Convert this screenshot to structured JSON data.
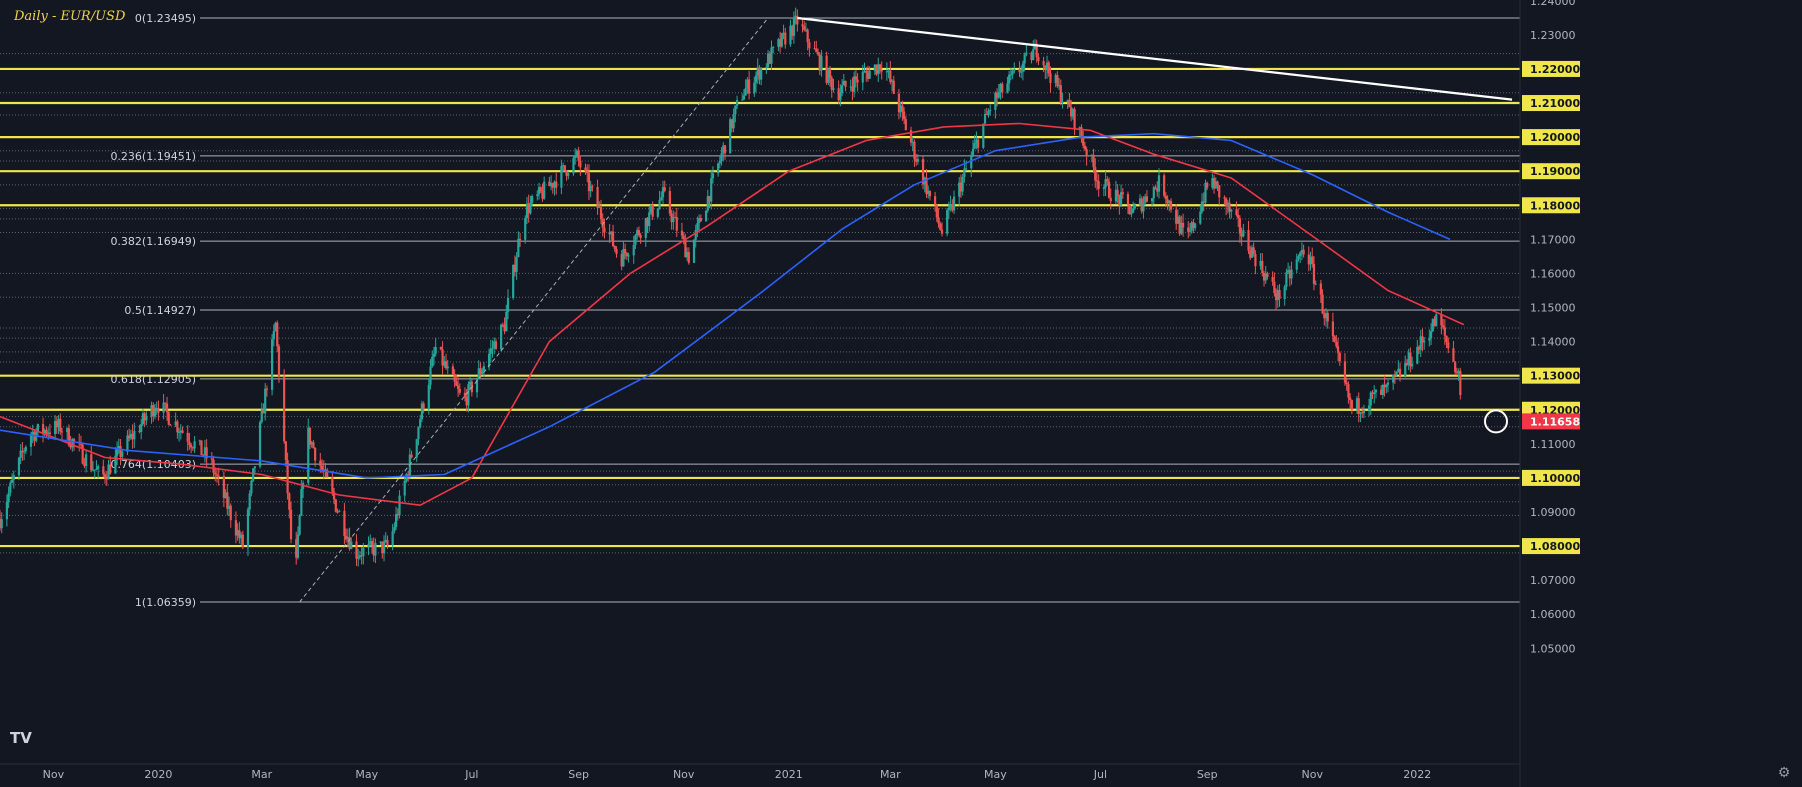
{
  "chart_data": {
    "type": "candlestick",
    "symbol": "EUR/USD",
    "interval": "Daily",
    "title": "Daily - EUR/USD",
    "last_price": 1.11658,
    "ylim": [
      1.0463,
      1.2412
    ],
    "y_ticks": [
      1.05,
      1.06,
      1.07,
      1.08,
      1.09,
      1.1,
      1.11,
      1.12,
      1.13,
      1.14,
      1.15,
      1.16,
      1.17,
      1.18,
      1.19,
      1.2,
      1.21,
      1.22,
      1.23,
      1.24
    ],
    "x_ticks": [
      {
        "label": "Nov",
        "date": "2019-11-01"
      },
      {
        "label": "2020",
        "date": "2020-01-01"
      },
      {
        "label": "Mar",
        "date": "2020-03-01"
      },
      {
        "label": "May",
        "date": "2020-05-01"
      },
      {
        "label": "Jul",
        "date": "2020-07-01"
      },
      {
        "label": "Sep",
        "date": "2020-09-01"
      },
      {
        "label": "Nov",
        "date": "2020-11-01"
      },
      {
        "label": "2021",
        "date": "2021-01-01"
      },
      {
        "label": "Mar",
        "date": "2021-03-01"
      },
      {
        "label": "May",
        "date": "2021-05-01"
      },
      {
        "label": "Jul",
        "date": "2021-07-01"
      },
      {
        "label": "Sep",
        "date": "2021-09-01"
      },
      {
        "label": "Nov",
        "date": "2021-11-01"
      },
      {
        "label": "2022",
        "date": "2022-01-01"
      }
    ],
    "price_path": [
      [
        "2019-10-01",
        1.088
      ],
      [
        "2019-10-18",
        1.113
      ],
      [
        "2019-11-05",
        1.115
      ],
      [
        "2019-11-29",
        1.1
      ],
      [
        "2019-12-31",
        1.122
      ],
      [
        "2020-01-31",
        1.105
      ],
      [
        "2020-02-19",
        1.08
      ],
      [
        "2020-03-09",
        1.145
      ],
      [
        "2020-03-20",
        1.068
      ],
      [
        "2020-03-27",
        1.114
      ],
      [
        "2020-04-24",
        1.078
      ],
      [
        "2020-05-14",
        1.08
      ],
      [
        "2020-05-29",
        1.111
      ],
      [
        "2020-06-10",
        1.138
      ],
      [
        "2020-06-26",
        1.122
      ],
      [
        "2020-07-20",
        1.145
      ],
      [
        "2020-07-31",
        1.178
      ],
      [
        "2020-08-31",
        1.194
      ],
      [
        "2020-09-25",
        1.164
      ],
      [
        "2020-10-20",
        1.183
      ],
      [
        "2020-11-04",
        1.165
      ],
      [
        "2020-12-04",
        1.212
      ],
      [
        "2021-01-06",
        1.234
      ],
      [
        "2021-01-29",
        1.213
      ],
      [
        "2021-02-25",
        1.222
      ],
      [
        "2021-03-31",
        1.172
      ],
      [
        "2021-04-29",
        1.21
      ],
      [
        "2021-05-25",
        1.226
      ],
      [
        "2021-06-16",
        1.205
      ],
      [
        "2021-06-30",
        1.187
      ],
      [
        "2021-07-20",
        1.178
      ],
      [
        "2021-08-05",
        1.187
      ],
      [
        "2021-08-20",
        1.169
      ],
      [
        "2021-09-03",
        1.188
      ],
      [
        "2021-10-12",
        1.153
      ],
      [
        "2021-10-28",
        1.168
      ],
      [
        "2021-11-24",
        1.12
      ],
      [
        "2021-12-15",
        1.126
      ],
      [
        "2021-12-31",
        1.137
      ],
      [
        "2022-01-13",
        1.147
      ],
      [
        "2022-01-25",
        1.13
      ],
      [
        "2022-01-28",
        1.1166
      ]
    ],
    "series": [
      {
        "color": "#f23645",
        "path": [
          [
            "2019-10-01",
            1.118
          ],
          [
            "2019-12-01",
            1.106
          ],
          [
            "2020-01-15",
            1.104
          ],
          [
            "2020-03-01",
            1.101
          ],
          [
            "2020-04-15",
            1.095
          ],
          [
            "2020-06-01",
            1.092
          ],
          [
            "2020-07-01",
            1.1
          ],
          [
            "2020-08-15",
            1.14
          ],
          [
            "2020-10-01",
            1.16
          ],
          [
            "2020-11-15",
            1.174
          ],
          [
            "2021-01-01",
            1.19
          ],
          [
            "2021-02-15",
            1.199
          ],
          [
            "2021-04-01",
            1.203
          ],
          [
            "2021-05-15",
            1.204
          ],
          [
            "2021-06-25",
            1.202
          ],
          [
            "2021-08-01",
            1.195
          ],
          [
            "2021-09-15",
            1.188
          ],
          [
            "2021-11-01",
            1.171
          ],
          [
            "2021-12-15",
            1.155
          ],
          [
            "2022-01-28",
            1.145
          ]
        ]
      },
      {
        "color": "#2962ff",
        "path": [
          [
            "2019-10-01",
            1.114
          ],
          [
            "2019-12-15",
            1.108
          ],
          [
            "2020-03-01",
            1.105
          ],
          [
            "2020-05-01",
            1.1
          ],
          [
            "2020-06-15",
            1.101
          ],
          [
            "2020-08-15",
            1.115
          ],
          [
            "2020-10-15",
            1.131
          ],
          [
            "2020-12-15",
            1.154
          ],
          [
            "2021-02-01",
            1.173
          ],
          [
            "2021-03-15",
            1.186
          ],
          [
            "2021-05-01",
            1.196
          ],
          [
            "2021-06-20",
            1.2
          ],
          [
            "2021-08-01",
            1.201
          ],
          [
            "2021-09-15",
            1.199
          ],
          [
            "2021-11-01",
            1.189
          ],
          [
            "2021-12-15",
            1.178
          ],
          [
            "2022-01-20",
            1.17
          ]
        ]
      }
    ],
    "trendline": [
      [
        "2021-01-06",
        1.23495
      ],
      [
        "2022-02-25",
        1.211
      ]
    ],
    "fib_anchor_line": [
      [
        "2020-03-23",
        1.06359
      ],
      [
        "2020-12-20",
        1.23495
      ]
    ],
    "fibonacci": [
      {
        "label": "0(1.23495)",
        "value": 1.23495
      },
      {
        "label": "0.236(1.19451)",
        "value": 1.19451
      },
      {
        "label": "0.382(1.16949)",
        "value": 1.16949
      },
      {
        "label": "0.5(1.14927)",
        "value": 1.14927
      },
      {
        "label": "0.618(1.12905)",
        "value": 1.12905
      },
      {
        "label": "0.764(1.10403)",
        "value": 1.10403
      },
      {
        "label": "1(1.06359)",
        "value": 1.06359
      }
    ],
    "horizontal_levels": [
      {
        "label": "1.22000",
        "value": 1.22
      },
      {
        "label": "1.21000",
        "value": 1.21
      },
      {
        "label": "1.20000",
        "value": 1.2
      },
      {
        "label": "1.19000",
        "value": 1.19
      },
      {
        "label": "1.18000",
        "value": 1.18
      },
      {
        "label": "1.13000",
        "value": 1.13
      },
      {
        "label": "1.12000",
        "value": 1.12
      },
      {
        "label": "1.10000",
        "value": 1.1
      },
      {
        "label": "1.08000",
        "value": 1.08
      }
    ],
    "dotted_levels": [
      1.2245,
      1.213,
      1.2065,
      1.196,
      1.193,
      1.186,
      1.179,
      1.176,
      1.172,
      1.16,
      1.153,
      1.144,
      1.141,
      1.137,
      1.134,
      1.118,
      1.115,
      1.102,
      1.098,
      1.093,
      1.089,
      1.078
    ],
    "last_price_label": "1.11658",
    "colors": {
      "background": "#131722",
      "level": "#f0e64a",
      "up": "#26a69a",
      "down": "#ef5350",
      "axis_text": "#b2b5be",
      "price_tag": "#f23645"
    }
  },
  "chart_title": "Daily - EUR/USD",
  "logo_text": "TV",
  "settings_icon": "gear-icon"
}
